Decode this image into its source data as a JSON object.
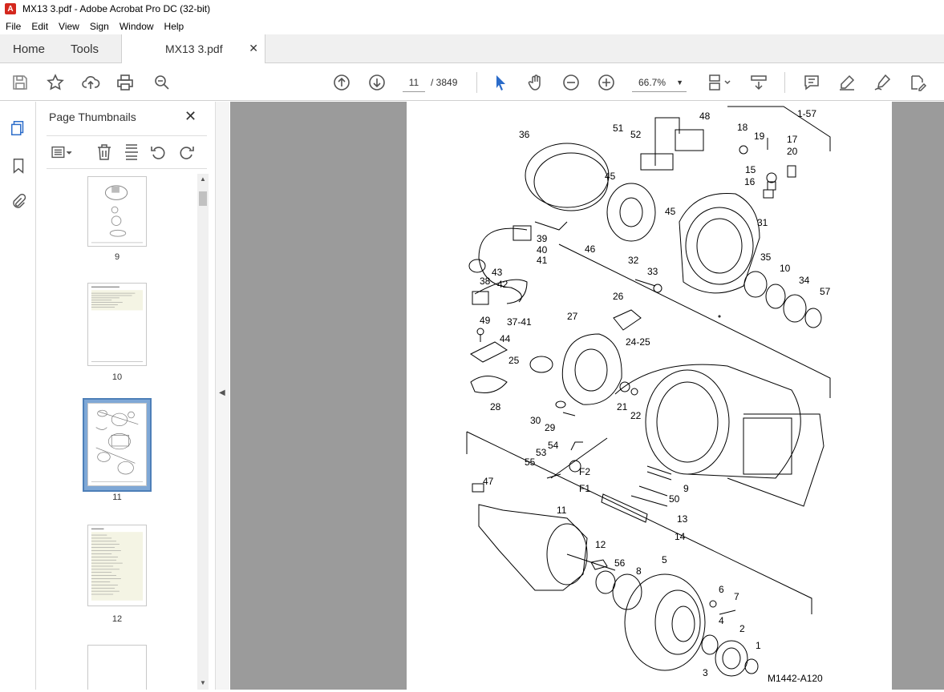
{
  "window": {
    "title": "MX13 3.pdf - Adobe Acrobat Pro DC (32-bit)",
    "app_icon": "acrobat-icon"
  },
  "menu": [
    "File",
    "Edit",
    "View",
    "Sign",
    "Window",
    "Help"
  ],
  "tabs": {
    "home": "Home",
    "tools": "Tools",
    "document": "MX13 3.pdf"
  },
  "toolbar": {
    "current_page": "11",
    "page_total": "/ 3849",
    "zoom": "66.7%"
  },
  "panel": {
    "title": "Page Thumbnails",
    "thumbnails": [
      {
        "label": "9"
      },
      {
        "label": "10"
      },
      {
        "label": "11",
        "selected": true
      },
      {
        "label": "12"
      }
    ]
  },
  "drawing": {
    "labels": [
      "1-57",
      "36",
      "51",
      "52",
      "48",
      "18",
      "19",
      "17",
      "20",
      "15",
      "16",
      "45",
      "45",
      "31",
      "46",
      "39",
      "40",
      "41",
      "43",
      "38",
      "42",
      "37-41",
      "32",
      "33",
      "35",
      "10",
      "34",
      "57",
      "26",
      "27",
      "24-25",
      "49",
      "44",
      "25",
      "28",
      "21",
      "22",
      "30",
      "29",
      "54",
      "53",
      "F2",
      "55",
      "F1",
      "47",
      "9",
      "50",
      "13",
      "14",
      "11",
      "12",
      "56",
      "8",
      "5",
      "6",
      "7",
      "4",
      "2",
      "1",
      "3"
    ],
    "figure_id": "M1442-A120"
  }
}
